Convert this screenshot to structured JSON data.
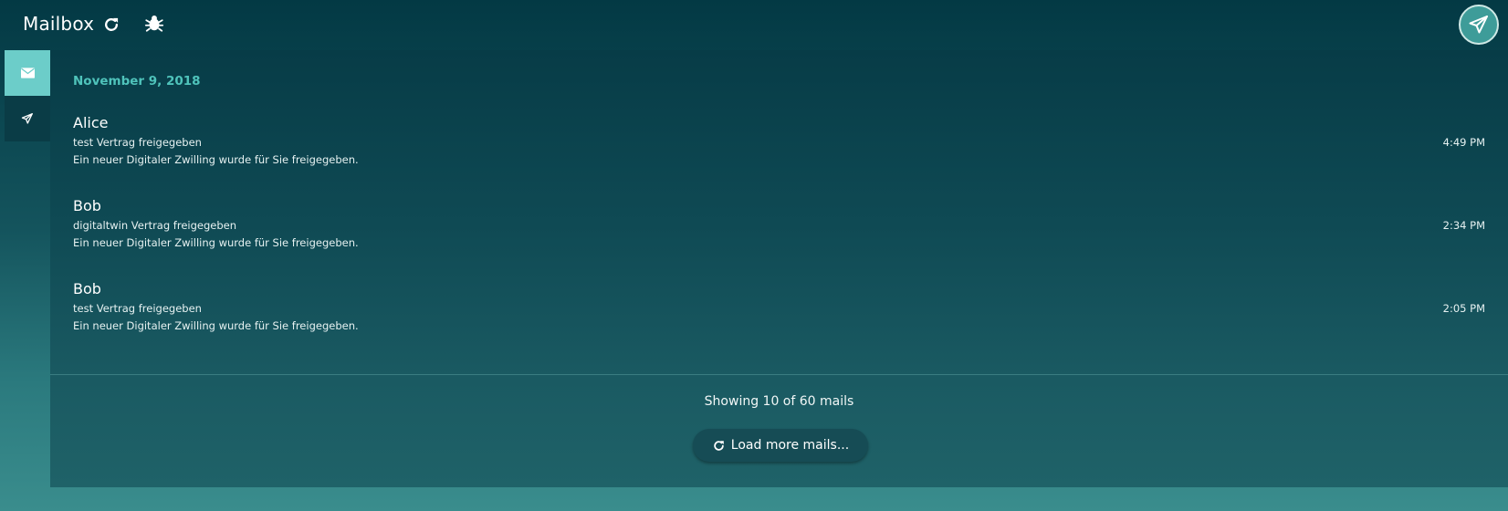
{
  "header": {
    "title": "Mailbox",
    "refresh_icon": "refresh-icon",
    "debug_icon": "bug-icon",
    "compose_icon": "paper-plane-icon"
  },
  "sidebar": {
    "tabs": [
      {
        "icon": "envelope-icon",
        "active": true
      },
      {
        "icon": "paper-plane-icon",
        "active": false
      }
    ]
  },
  "mailbox": {
    "date_heading": "November 9, 2018",
    "mails": [
      {
        "sender": "Alice",
        "subject": "test Vertrag freigegeben",
        "preview": "Ein neuer Digitaler Zwilling wurde für Sie freigegeben.",
        "time": "4:49 PM"
      },
      {
        "sender": "Bob",
        "subject": "digitaltwin Vertrag freigegeben",
        "preview": "Ein neuer Digitaler Zwilling wurde für Sie freigegeben.",
        "time": "2:34 PM"
      },
      {
        "sender": "Bob",
        "subject": "test Vertrag freigegeben",
        "preview": "Ein neuer Digitaler Zwilling wurde für Sie freigegeben.",
        "time": "2:05 PM"
      }
    ],
    "footer_count": "Showing 10 of 60 mails",
    "load_more_label": "Load more mails..."
  },
  "colors": {
    "accent": "#6ccdc9",
    "date_heading": "#4fc3bb",
    "compose_button": "#3e9c99"
  }
}
